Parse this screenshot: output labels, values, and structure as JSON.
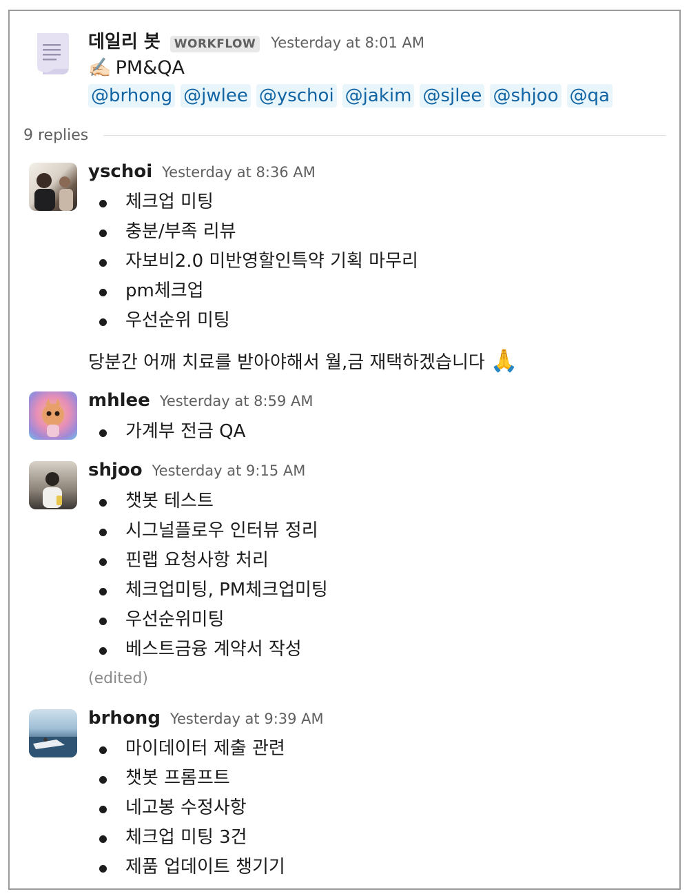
{
  "parent": {
    "bot_name": "데일리 봇",
    "badge": "WORKFLOW",
    "time": "Yesterday at 8:01 AM",
    "title_emoji": "✍🏻",
    "title": "PM&QA",
    "mentions": [
      "@brhong",
      "@jwlee",
      "@yschoi",
      "@jakim",
      "@sjlee",
      "@shjoo",
      "@qa"
    ]
  },
  "replies_label": "9 replies",
  "messages": [
    {
      "user": "yschoi",
      "time": "Yesterday at 8:36 AM",
      "items": [
        "체크업 미팅",
        "충분/부족 리뷰",
        "자보비2.0 미반영할인특약 기획 마무리",
        "pm체크업",
        "우선순위 미팅"
      ],
      "note": "당분간 어깨 치료를 받아야해서 월,금 재택하겠습니다",
      "note_emoji": "🙏"
    },
    {
      "user": "mhlee",
      "time": "Yesterday at 8:59 AM",
      "items": [
        "가계부 전금 QA"
      ]
    },
    {
      "user": "shjoo",
      "time": "Yesterday at 9:15 AM",
      "items": [
        "챗봇 테스트",
        "시그널플로우 인터뷰 정리",
        "핀랩 요청사항 처리",
        "체크업미팅, PM체크업미팅",
        "우선순위미팅",
        "베스트금융 계약서 작성"
      ],
      "edited": "(edited)"
    },
    {
      "user": "brhong",
      "time": "Yesterday at 9:39 AM",
      "items": [
        "마이데이터 제출 관련",
        "챗봇 프롬프트",
        "네고봉 수정사항",
        "체크업 미팅 3건",
        "제품 업데이트 챙기기"
      ]
    }
  ],
  "colors": {
    "mention_bg": "#e8f5fa",
    "mention_text": "#1264a3",
    "border": "#9a9a9a"
  }
}
